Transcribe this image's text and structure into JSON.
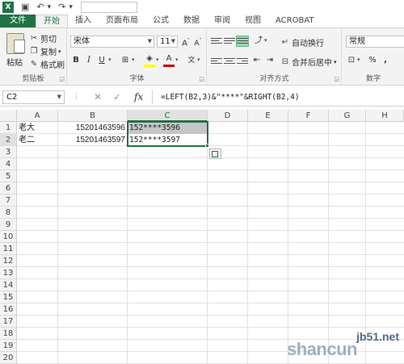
{
  "quick_access": {
    "save_icon": "save-icon",
    "undo_icon": "undo-icon",
    "redo_icon": "redo-icon"
  },
  "tabs": [
    {
      "label": "文件"
    },
    {
      "label": "开始"
    },
    {
      "label": "插入"
    },
    {
      "label": "页面布局"
    },
    {
      "label": "公式"
    },
    {
      "label": "数据"
    },
    {
      "label": "审阅"
    },
    {
      "label": "视图"
    },
    {
      "label": "ACROBAT"
    }
  ],
  "ribbon": {
    "clipboard": {
      "paste": "粘贴",
      "cut": "剪切",
      "copy": "复制",
      "format_painter": "格式刷",
      "group": "剪贴板"
    },
    "font": {
      "name": "宋体",
      "size": "11",
      "bold": "B",
      "italic": "I",
      "underline": "U",
      "grow": "A",
      "shrink": "A",
      "group": "字体",
      "font_color": "#c00000",
      "fill_color": "#ffff00"
    },
    "alignment": {
      "wrap": "自动换行",
      "merge": "合并后居中",
      "group": "对齐方式"
    },
    "number": {
      "format": "常规",
      "percent": "%",
      "comma": ",",
      "group": "数字"
    }
  },
  "formula_bar": {
    "cell_ref": "C2",
    "fx": "fx",
    "formula": "=LEFT(B2,3)&\"****\"&RIGHT(B2,4)"
  },
  "columns": [
    "A",
    "B",
    "C",
    "D",
    "E",
    "F",
    "G",
    "H"
  ],
  "rows": [
    "1",
    "2",
    "3",
    "4",
    "5",
    "6",
    "7",
    "8",
    "9",
    "10",
    "11",
    "12",
    "13",
    "14",
    "15",
    "16",
    "17",
    "18",
    "19",
    "20"
  ],
  "cells": {
    "A1": "老大",
    "B1": "15201463596",
    "C1": "152****3596",
    "A2": "老二",
    "B2": "15201463597",
    "C2": "152****3597"
  },
  "selected_cell": "C2",
  "watermark": {
    "url": "jb51.net",
    "brand": "shancun"
  },
  "accent_color": "#217346"
}
